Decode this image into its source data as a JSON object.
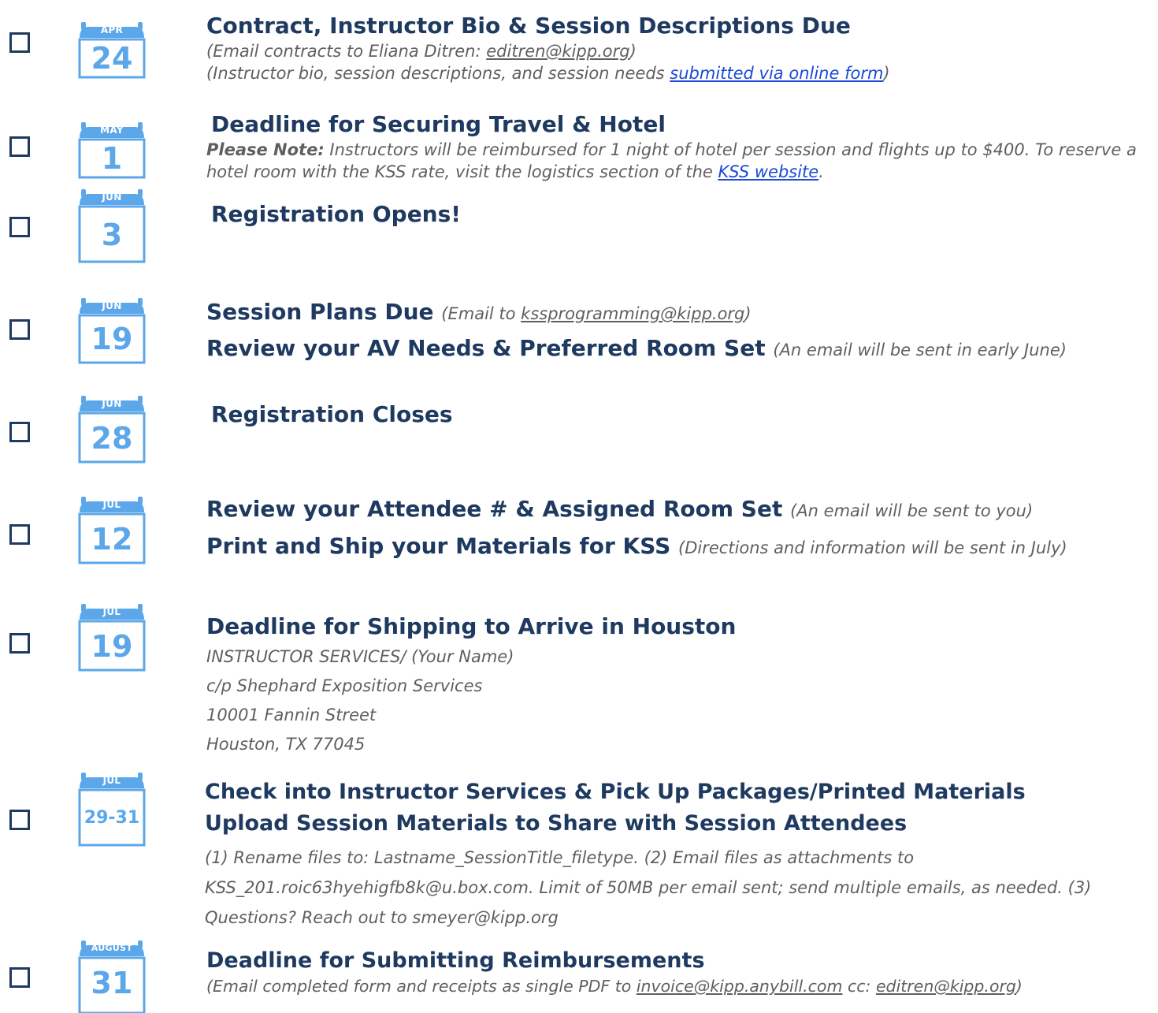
{
  "items": [
    {
      "month": "APR",
      "day": "24",
      "title": "Contract, Instructor Bio & Session Descriptions Due",
      "line1_pre": "(Email contracts to Eliana Ditren: ",
      "line1_email": "editren@kipp.org",
      "line1_post": ")",
      "line2_pre": "(Instructor bio, session descriptions, and session needs ",
      "line2_link": "submitted via online form",
      "line2_post": ")"
    },
    {
      "month": "MAY",
      "day": "1",
      "title": "Deadline for Securing Travel & Hotel",
      "note_label": "Please Note:",
      "note_text": " Instructors will be reimbursed for 1 night of hotel per session and flights up to $400. To reserve a hotel room with the KSS rate, visit the logistics section of the ",
      "note_link": "KSS website",
      "note_end": "."
    },
    {
      "month": "JUN",
      "day": "3",
      "title": "Registration Opens!"
    },
    {
      "month": "JUN",
      "day": "19",
      "title1": "Session Plans Due",
      "aside1_pre": "(Email to ",
      "aside1_email": "kssprogramming@kipp.org",
      "aside1_post": ")",
      "title2": "Review your AV Needs & Preferred Room Set",
      "aside2": "(An email will be sent in early June)"
    },
    {
      "month": "JUN",
      "day": "28",
      "title": "Registration Closes"
    },
    {
      "month": "JUL",
      "day": "12",
      "title1": "Review your Attendee # & Assigned Room Set",
      "aside1": "(An email will be sent to you)",
      "title2": "Print and Ship your Materials for KSS",
      "aside2": "(Directions and information will be sent in July)"
    },
    {
      "month": "JUL",
      "day": "19",
      "title": "Deadline for Shipping to Arrive in Houston",
      "address": [
        "INSTRUCTOR SERVICES/ (Your Name)",
        "c/p Shephard Exposition Services",
        "10001 Fannin Street",
        "Houston, TX 77045"
      ]
    },
    {
      "month": "JUL",
      "day": "29-31",
      "title1": "Check into Instructor Services & Pick Up Packages/Printed Materials",
      "title2": "Upload Session Materials to Share with Session Attendees",
      "note": "(1) Rename files to: Lastname_SessionTitle_filetype. (2) Email files as attachments to KSS_201.roic63hyehigfb8k@u.box.com. Limit of 50MB per email sent; send multiple emails, as needed. (3) Questions? Reach out to smeyer@kipp.org"
    },
    {
      "month": "AUGUST",
      "day": "31",
      "title": "Deadline for Submitting Reimbursements",
      "line_pre": "(Email completed form and receipts as single PDF to ",
      "line_email1": "invoice@kipp.anybill.com",
      "line_mid": " cc: ",
      "line_email2": "editren@kipp.org",
      "line_post": ")"
    }
  ],
  "colors": {
    "navy": "#1f3a60",
    "calendar_blue": "#5ba7ea",
    "note_gray": "#5f5f5f",
    "link_blue": "#1a4ad6"
  }
}
